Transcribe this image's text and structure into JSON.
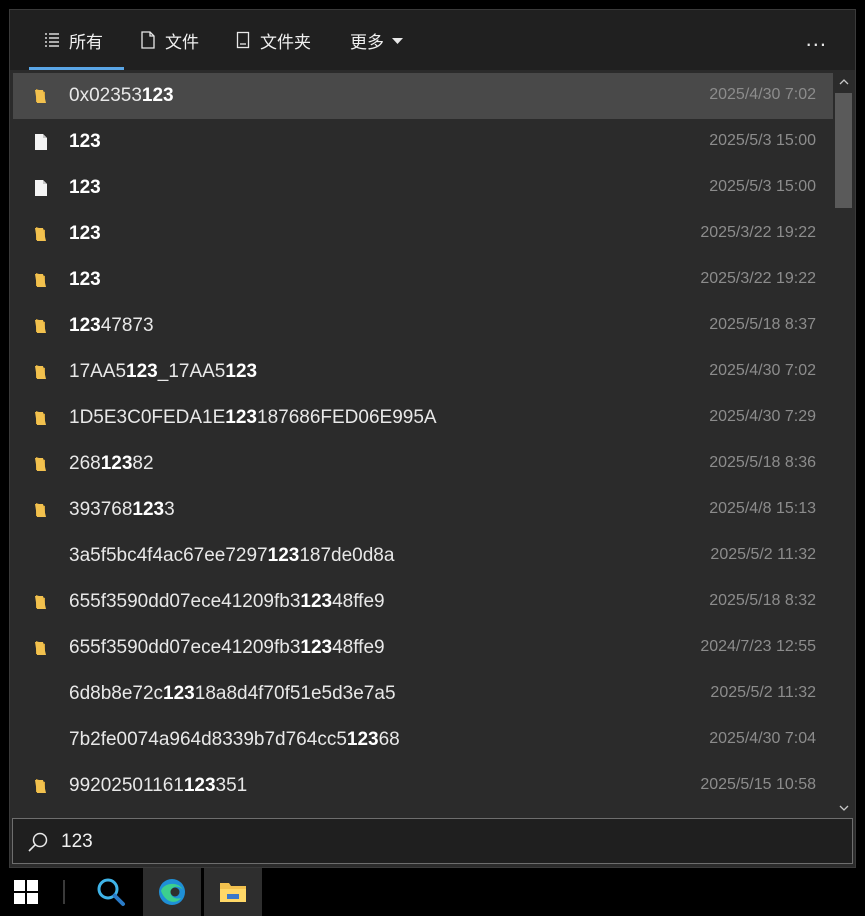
{
  "tabs": [
    {
      "label": "所有",
      "icon": "list-icon"
    },
    {
      "label": "文件",
      "icon": "file-icon"
    },
    {
      "label": "文件夹",
      "icon": "folder-outline-icon"
    },
    {
      "label": "更多",
      "icon": "chevron-down-icon"
    }
  ],
  "overflow_menu": "...",
  "rows": [
    {
      "type": "folder",
      "name_pre": "0x02353",
      "name_match": "123",
      "name_post": "",
      "date": "2025/4/30 7:02"
    },
    {
      "type": "file",
      "name_pre": "",
      "name_match": "123",
      "name_post": "",
      "date": "2025/5/3 15:00"
    },
    {
      "type": "file",
      "name_pre": "",
      "name_match": "123",
      "name_post": "",
      "date": "2025/5/3 15:00"
    },
    {
      "type": "folder",
      "name_pre": "",
      "name_match": "123",
      "name_post": "",
      "date": "2025/3/22 19:22"
    },
    {
      "type": "folder",
      "name_pre": "",
      "name_match": "123",
      "name_post": "",
      "date": "2025/3/22 19:22"
    },
    {
      "type": "folder",
      "name_pre": "",
      "name_match": "123",
      "name_post": "47873",
      "date": "2025/5/18 8:37"
    },
    {
      "type": "folder",
      "name_pre": "17AA5",
      "name_match": "123",
      "name_post": "_17AA5123",
      "date": "2025/4/30 7:02"
    },
    {
      "type": "folder",
      "name_pre": "1D5E3C0FEDA1E",
      "name_match": "123",
      "name_post": "187686FED06E995A",
      "date": "2025/4/30 7:29"
    },
    {
      "type": "folder",
      "name_pre": "268",
      "name_match": "123",
      "name_post": "82",
      "date": "2025/5/18 8:36"
    },
    {
      "type": "folder",
      "name_pre": "393768",
      "name_match": "123",
      "name_post": "3",
      "date": "2025/4/8 15:13"
    },
    {
      "type": "none",
      "name_pre": "3a5f5bc4f4ac67ee7297",
      "name_match": "123",
      "name_post": "187de0d8a",
      "date": "2025/5/2 11:32"
    },
    {
      "type": "folder",
      "name_pre": "655f3590dd07ece41209fb3",
      "name_match": "123",
      "name_post": "48ffe9",
      "date": "2025/5/18 8:32"
    },
    {
      "type": "folder",
      "name_pre": "655f3590dd07ece41209fb3",
      "name_match": "123",
      "name_post": "48ffe9",
      "date": "2024/7/23 12:55"
    },
    {
      "type": "none",
      "name_pre": "6d8b8e72c",
      "name_match": "123",
      "name_post": "18a8d4f70f51e5d3e7a5",
      "date": "2025/5/2 11:32"
    },
    {
      "type": "none",
      "name_pre": "7b2fe0074a964d8339b7d764cc5",
      "name_match": "123",
      "name_post": "68",
      "date": "2025/4/30 7:04"
    },
    {
      "type": "folder",
      "name_pre": "99202501161",
      "name_match": "123",
      "name_post": "351",
      "date": "2025/5/15 10:58"
    }
  ],
  "search": {
    "value": "123"
  },
  "colors": {
    "folder": "#f2c14e",
    "accent": "#5aa6e6",
    "selected_row": "#494949"
  },
  "taskbar": [
    "windows-start-icon",
    "search-magnifier-icon",
    "edge-browser-icon",
    "file-explorer-icon"
  ]
}
